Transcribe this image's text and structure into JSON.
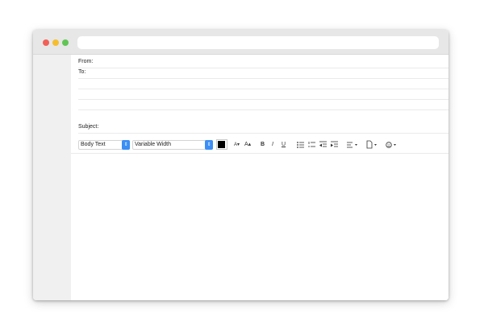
{
  "window": {
    "traffic_lights": {
      "close": "#f25f57",
      "minimize": "#f6be2f",
      "zoom": "#61c554"
    }
  },
  "compose": {
    "from": {
      "label": "From:",
      "value": ""
    },
    "to": {
      "label": "To:",
      "value": ""
    },
    "cc": {
      "label": "",
      "value": ""
    },
    "subject": {
      "label": "Subject:",
      "value": ""
    },
    "body": {
      "value": ""
    }
  },
  "toolbar": {
    "paragraph_style": "Body Text",
    "font": "Variable Width",
    "text_color": "#000000",
    "decrease_size": "A▾",
    "increase_size": "A▴",
    "bold": "B",
    "italic": "I",
    "underline": "U",
    "bulleted_list_icon": "bullet-list-icon",
    "numbered_list_icon": "numbered-list-icon",
    "outdent_icon": "outdent-icon",
    "indent_icon": "indent-icon",
    "align_icon": "align-left-icon",
    "attach_icon": "attachment-icon",
    "emoji_icon": "emoji-icon",
    "accent_color": "#3b8ef5"
  }
}
